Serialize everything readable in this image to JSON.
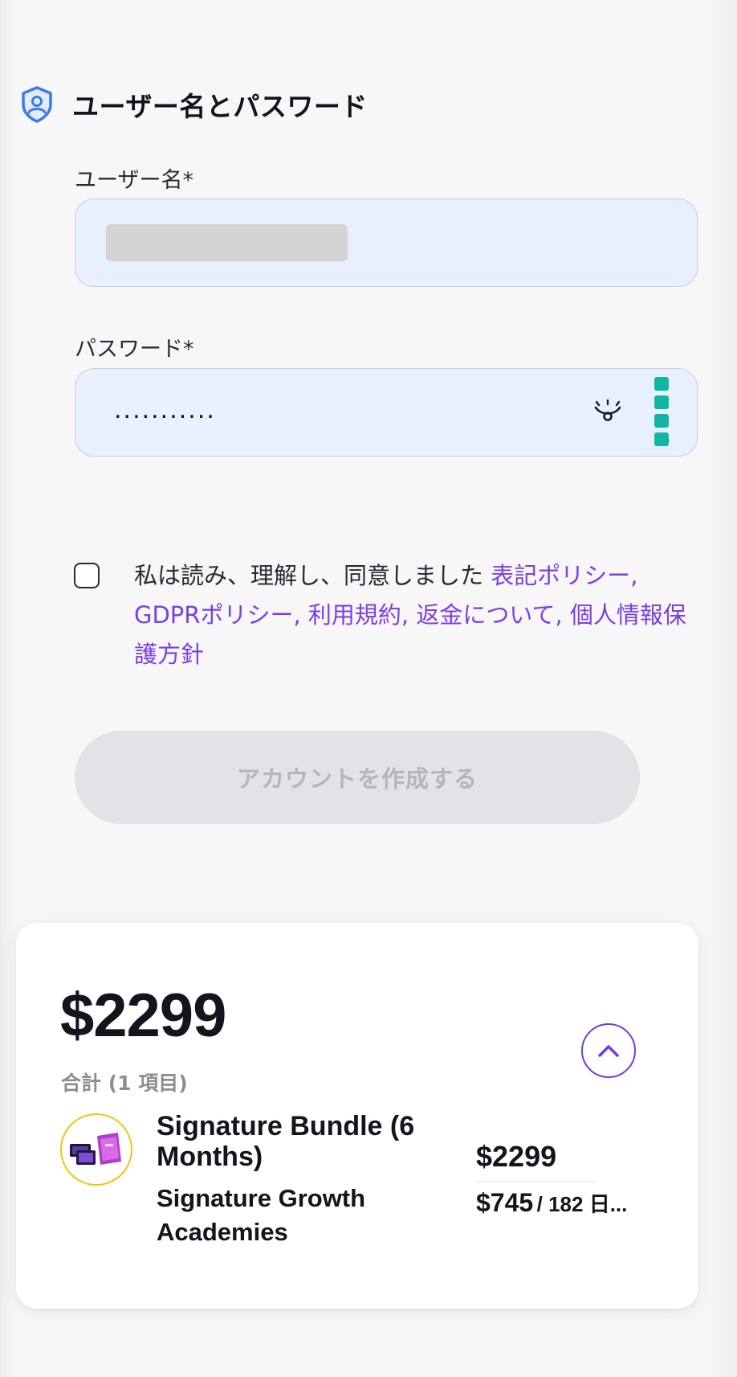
{
  "account": {
    "section_title": "ユーザー名とパスワード",
    "username_label": "ユーザー名*",
    "password_label": "パスワード*",
    "password_value": "...........",
    "consent_prefix": "私は読み、理解し、同意しました ",
    "policy_links": [
      "表記ポリシー,",
      "GDPRポリシー,",
      "利用規約,",
      "返金について,",
      "個人情報保護方針"
    ],
    "create_button_label": "アカウントを作成する"
  },
  "summary": {
    "total_price": "$2299",
    "total_label": "合計 (1 項目)",
    "item": {
      "name": "Signature Bundle (6 Months)",
      "vendor": "Signature Growth Academies",
      "price": "$2299",
      "installment_amount": "$745",
      "installment_period": "/ 182 日..."
    }
  },
  "colors": {
    "accent": "#7b3fe4",
    "field_bg": "#e8f0fe",
    "button_disabled_bg": "#e3e3e7",
    "button_disabled_text": "#b5b5bc",
    "password_manager": "#12b5a4",
    "thumb_ring": "#f2c511"
  },
  "icons": {
    "section": "shield-user-icon",
    "password_toggle": "eye-icon",
    "password_manager": "password-manager-icon",
    "collapse": "chevron-up-icon"
  }
}
